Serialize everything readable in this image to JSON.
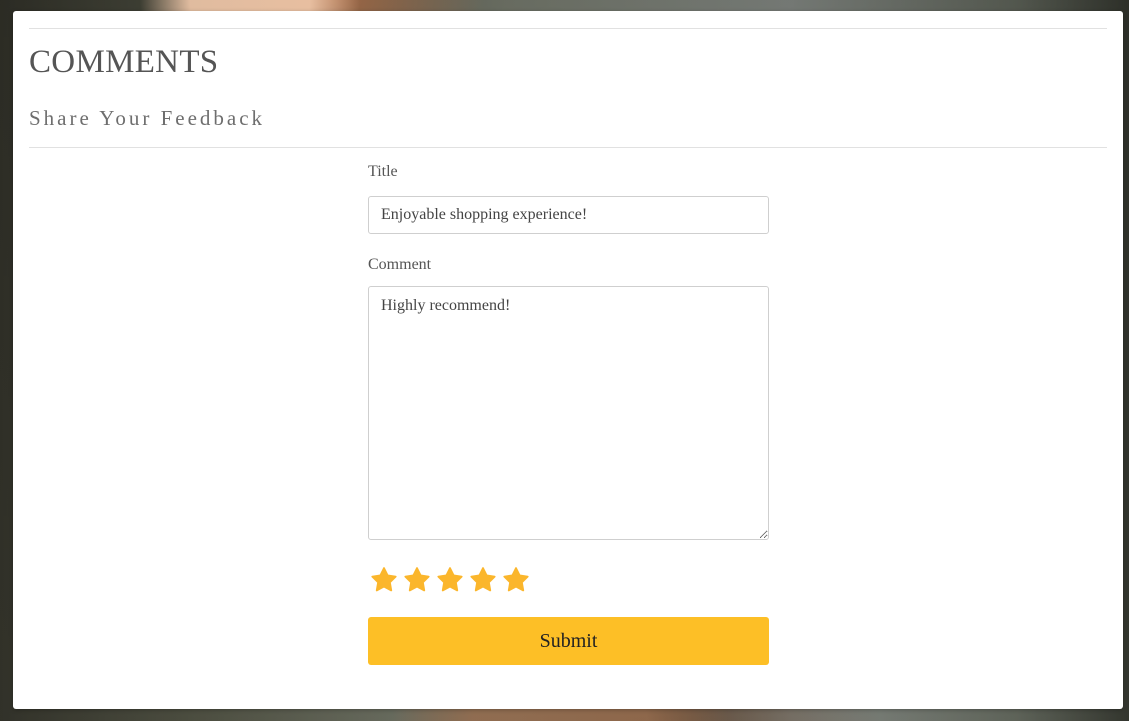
{
  "header": {
    "title": "COMMENTS",
    "subtitle": "Share Your Feedback"
  },
  "form": {
    "title_label": "Title",
    "title_value": "Enjoyable shopping experience!",
    "comment_label": "Comment",
    "comment_value": "Highly recommend!",
    "rating": {
      "value": 5,
      "max": 5,
      "icon": "star-icon",
      "filled_color": "#fbb62c"
    },
    "submit_label": "Submit"
  },
  "colors": {
    "submit_background": "#fdbf26",
    "panel_background": "#ffffff"
  }
}
